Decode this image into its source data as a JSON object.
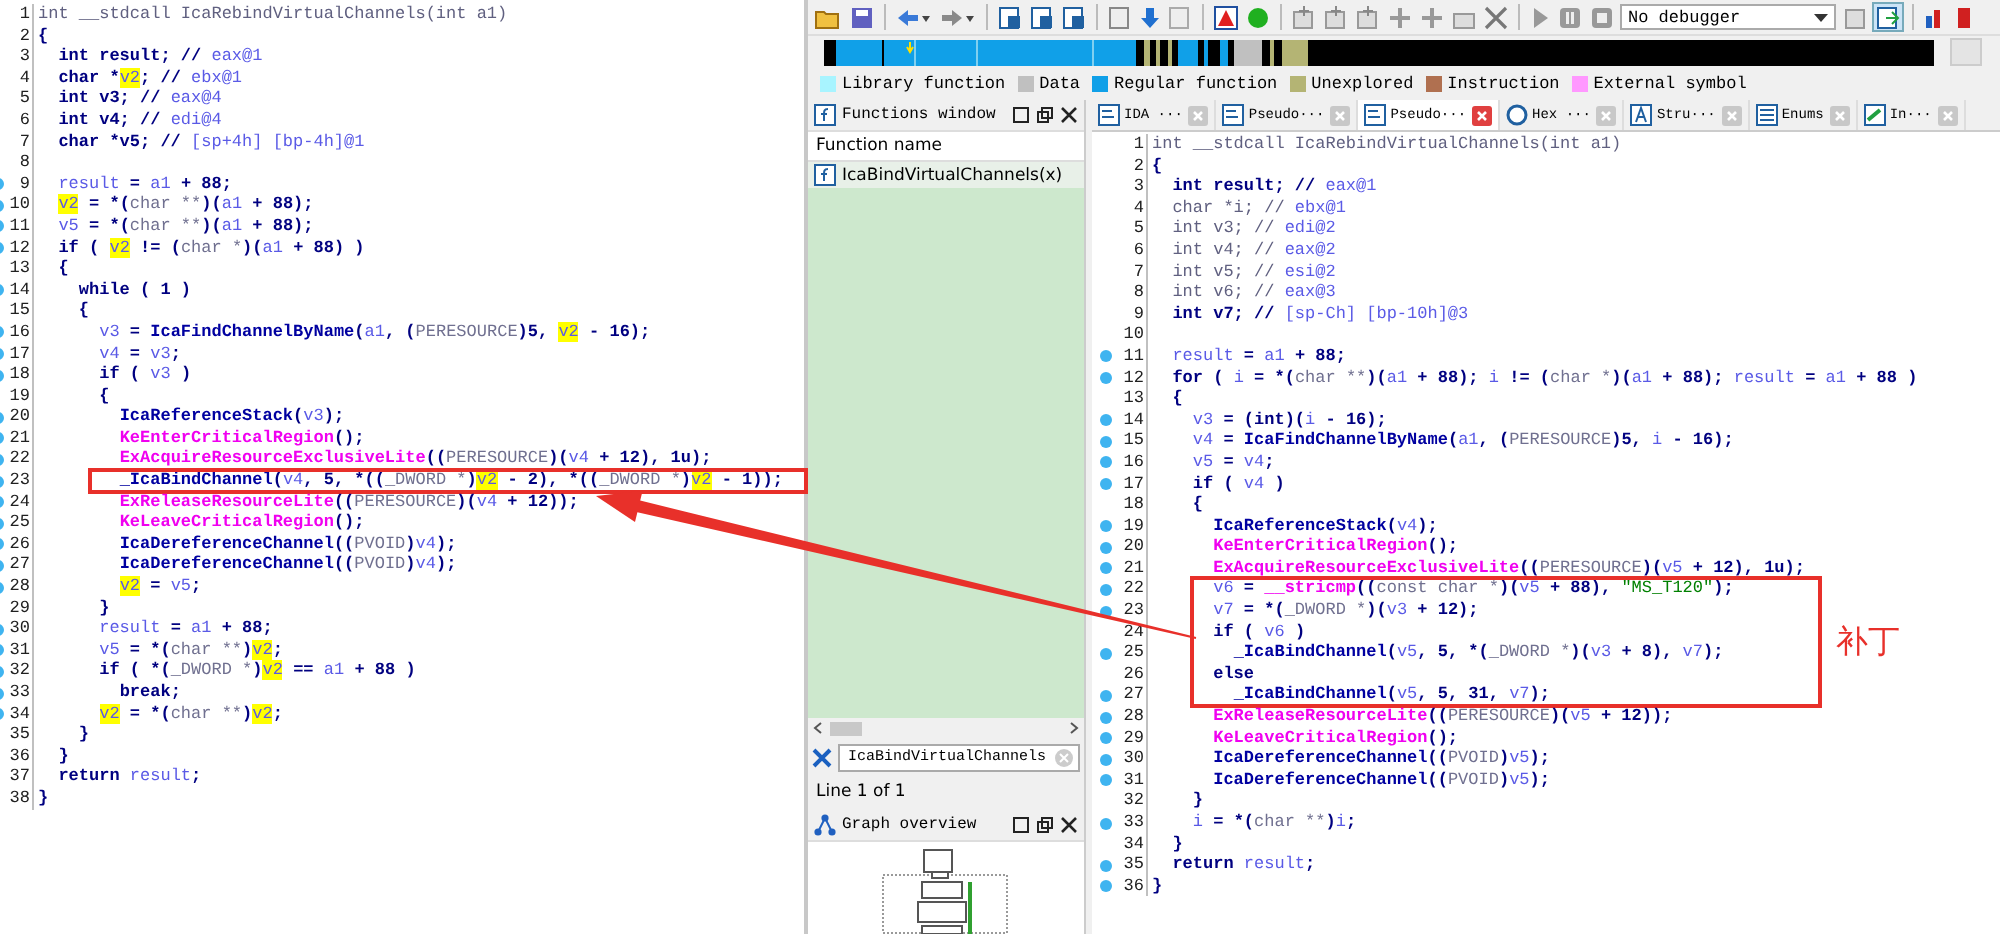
{
  "left_pane": {
    "lines_before": [
      {
        "number": "1",
        "dot": false,
        "tokens": [
          {
            "text": "int __stdcall IcaRebindVirtualChannels(int a1)",
            "kind": "dim"
          }
        ]
      },
      {
        "number": "2",
        "dot": false,
        "tokens": [
          {
            "text": "{",
            "kind": "plain"
          }
        ]
      },
      {
        "number": "3",
        "dot": false,
        "tokens": [
          {
            "text": "  int result; // ",
            "kind": "plain"
          },
          {
            "text": "eax@1",
            "kind": "var"
          }
        ]
      },
      {
        "number": "4",
        "dot": false,
        "tokens": [
          {
            "text": "  char *",
            "kind": "plain"
          },
          {
            "text": "v2",
            "kind": "mark"
          },
          {
            "text": "; // ",
            "kind": "plain"
          },
          {
            "text": "ebx@1",
            "kind": "var"
          }
        ]
      },
      {
        "number": "5",
        "dot": false,
        "tokens": [
          {
            "text": "  int v3; // ",
            "kind": "plain"
          },
          {
            "text": "eax@4",
            "kind": "var"
          }
        ]
      },
      {
        "number": "6",
        "dot": false,
        "tokens": [
          {
            "text": "  int v4; // ",
            "kind": "plain"
          },
          {
            "text": "edi@4",
            "kind": "var"
          }
        ]
      },
      {
        "number": "7",
        "dot": false,
        "tokens": [
          {
            "text": "  char *v5; // ",
            "kind": "plain"
          },
          {
            "text": "[sp+4h] [bp-4h]@1",
            "kind": "var"
          }
        ]
      },
      {
        "number": "8",
        "dot": false
      },
      {
        "number": "9",
        "dot": true,
        "tokens": [
          {
            "text": "  result",
            "kind": "var"
          },
          {
            "text": " = ",
            "kind": "plain"
          },
          {
            "text": "a1",
            "kind": "var"
          },
          {
            "text": " + 88;",
            "kind": "plain"
          }
        ]
      },
      {
        "number": "10",
        "dot": true,
        "tokens": [
          {
            "text": "  v2",
            "kind": "mark"
          },
          {
            "text": " = *(",
            "kind": "plain"
          },
          {
            "text": "char **",
            "kind": "cast"
          },
          {
            "text": ")(",
            "kind": "plain"
          },
          {
            "text": "a1",
            "kind": "var"
          },
          {
            "text": " + 88);",
            "kind": "plain"
          }
        ]
      },
      {
        "number": "11",
        "dot": true,
        "tokens": [
          {
            "text": "  v5",
            "kind": "var"
          },
          {
            "text": " = *(",
            "kind": "plain"
          },
          {
            "text": "char **",
            "kind": "cast"
          },
          {
            "text": ")(",
            "kind": "plain"
          },
          {
            "text": "a1",
            "kind": "var"
          },
          {
            "text": " + 88);",
            "kind": "plain"
          }
        ]
      },
      {
        "number": "12",
        "dot": true,
        "tokens": [
          {
            "text": "  if ( ",
            "kind": "plain"
          },
          {
            "text": "v2",
            "kind": "mark"
          },
          {
            "text": " != (",
            "kind": "plain"
          },
          {
            "text": "char *",
            "kind": "cast"
          },
          {
            "text": ")(",
            "kind": "plain"
          },
          {
            "text": "a1",
            "kind": "var"
          },
          {
            "text": " + 88) )",
            "kind": "plain"
          }
        ]
      },
      {
        "number": "13",
        "dot": false,
        "tokens": [
          {
            "text": "  {",
            "kind": "plain"
          }
        ]
      },
      {
        "number": "14",
        "dot": true,
        "tokens": [
          {
            "text": "    while ( 1 )",
            "kind": "plain"
          }
        ]
      },
      {
        "number": "15",
        "dot": false,
        "tokens": [
          {
            "text": "    {",
            "kind": "plain"
          }
        ]
      },
      {
        "number": "16",
        "dot": true,
        "tokens": [
          {
            "text": "      v3",
            "kind": "var"
          },
          {
            "text": " = ",
            "kind": "plain"
          },
          {
            "text": "IcaFindChannelByName",
            "kind": "func"
          },
          {
            "text": "(",
            "kind": "plain"
          },
          {
            "text": "a1",
            "kind": "var"
          },
          {
            "text": ", (",
            "kind": "plain"
          },
          {
            "text": "PERESOURCE",
            "kind": "cast"
          },
          {
            "text": ")5, ",
            "kind": "plain"
          },
          {
            "text": "v2",
            "kind": "mark"
          },
          {
            "text": " - 16);",
            "kind": "plain"
          }
        ]
      },
      {
        "number": "17",
        "dot": true,
        "tokens": [
          {
            "text": "      v4",
            "kind": "var"
          },
          {
            "text": " = ",
            "kind": "plain"
          },
          {
            "text": "v3",
            "kind": "var"
          },
          {
            "text": ";",
            "kind": "plain"
          }
        ]
      },
      {
        "number": "18",
        "dot": true,
        "tokens": [
          {
            "text": "      if ( ",
            "kind": "plain"
          },
          {
            "text": "v3",
            "kind": "var"
          },
          {
            "text": " )",
            "kind": "plain"
          }
        ]
      },
      {
        "number": "19",
        "dot": false,
        "tokens": [
          {
            "text": "      {",
            "kind": "plain"
          }
        ]
      },
      {
        "number": "20",
        "dot": true,
        "tokens": [
          {
            "text": "        IcaReferenceStack",
            "kind": "func"
          },
          {
            "text": "(",
            "kind": "plain"
          },
          {
            "text": "v3",
            "kind": "var"
          },
          {
            "text": ");",
            "kind": "plain"
          }
        ]
      },
      {
        "number": "21",
        "dot": true,
        "tokens": [
          {
            "text": "        KeEnterCriticalRegion",
            "kind": "import"
          },
          {
            "text": "();",
            "kind": "plain"
          }
        ]
      },
      {
        "number": "22",
        "dot": true,
        "tokens": [
          {
            "text": "        ExAcquireResourceExclusiveLite",
            "kind": "import"
          },
          {
            "text": "((",
            "kind": "plain"
          },
          {
            "text": "PERESOURCE",
            "kind": "cast"
          },
          {
            "text": ")(",
            "kind": "plain"
          },
          {
            "text": "v4",
            "kind": "var"
          },
          {
            "text": " + 12), 1u);",
            "kind": "plain"
          }
        ]
      }
    ],
    "boxed_lines": [
      {
        "number": "23",
        "dot": true,
        "tokens": [
          {
            "text": "        _IcaBindChannel",
            "kind": "func"
          },
          {
            "text": "(",
            "kind": "plain"
          },
          {
            "text": "v4",
            "kind": "var"
          },
          {
            "text": ", 5, *((",
            "kind": "plain"
          },
          {
            "text": "_DWORD *",
            "kind": "cast"
          },
          {
            "text": ")",
            "kind": "plain"
          },
          {
            "text": "v2",
            "kind": "mark"
          },
          {
            "text": " - 2), *((",
            "kind": "plain"
          },
          {
            "text": "_DWORD *",
            "kind": "cast"
          },
          {
            "text": ")",
            "kind": "plain"
          },
          {
            "text": "v2",
            "kind": "mark"
          },
          {
            "text": " - 1));",
            "kind": "plain"
          }
        ]
      }
    ],
    "lines_after": [
      {
        "number": "24",
        "dot": true,
        "tokens": [
          {
            "text": "        ExReleaseResourceLite",
            "kind": "import"
          },
          {
            "text": "((",
            "kind": "plain"
          },
          {
            "text": "PERESOURCE",
            "kind": "cast"
          },
          {
            "text": ")(",
            "kind": "plain"
          },
          {
            "text": "v4",
            "kind": "var"
          },
          {
            "text": " + 12));",
            "kind": "plain"
          }
        ]
      },
      {
        "number": "25",
        "dot": true,
        "tokens": [
          {
            "text": "        KeLeaveCriticalRegion",
            "kind": "import"
          },
          {
            "text": "();",
            "kind": "plain"
          }
        ]
      },
      {
        "number": "26",
        "dot": true,
        "tokens": [
          {
            "text": "        IcaDereferenceChannel",
            "kind": "func"
          },
          {
            "text": "((",
            "kind": "plain"
          },
          {
            "text": "PVOID",
            "kind": "cast"
          },
          {
            "text": ")",
            "kind": "plain"
          },
          {
            "text": "v4",
            "kind": "var"
          },
          {
            "text": ");",
            "kind": "plain"
          }
        ]
      },
      {
        "number": "27",
        "dot": true,
        "tokens": [
          {
            "text": "        IcaDereferenceChannel",
            "kind": "func"
          },
          {
            "text": "((",
            "kind": "plain"
          },
          {
            "text": "PVOID",
            "kind": "cast"
          },
          {
            "text": ")",
            "kind": "plain"
          },
          {
            "text": "v4",
            "kind": "var"
          },
          {
            "text": ");",
            "kind": "plain"
          }
        ]
      },
      {
        "number": "28",
        "dot": true,
        "tokens": [
          {
            "text": "        v2",
            "kind": "mark"
          },
          {
            "text": " = ",
            "kind": "plain"
          },
          {
            "text": "v5",
            "kind": "var"
          },
          {
            "text": ";",
            "kind": "plain"
          }
        ]
      },
      {
        "number": "29",
        "dot": false,
        "tokens": [
          {
            "text": "      }",
            "kind": "plain"
          }
        ]
      },
      {
        "number": "30",
        "dot": true,
        "tokens": [
          {
            "text": "      result",
            "kind": "var"
          },
          {
            "text": " = ",
            "kind": "plain"
          },
          {
            "text": "a1",
            "kind": "var"
          },
          {
            "text": " + 88;",
            "kind": "plain"
          }
        ]
      },
      {
        "number": "31",
        "dot": true,
        "tokens": [
          {
            "text": "      v5",
            "kind": "var"
          },
          {
            "text": " = *(",
            "kind": "plain"
          },
          {
            "text": "char **",
            "kind": "cast"
          },
          {
            "text": ")",
            "kind": "plain"
          },
          {
            "text": "v2",
            "kind": "mark"
          },
          {
            "text": ";",
            "kind": "plain"
          }
        ]
      },
      {
        "number": "32",
        "dot": true,
        "tokens": [
          {
            "text": "      if ( *(",
            "kind": "plain"
          },
          {
            "text": "_DWORD *",
            "kind": "cast"
          },
          {
            "text": ")",
            "kind": "plain"
          },
          {
            "text": "v2",
            "kind": "mark"
          },
          {
            "text": " == ",
            "kind": "plain"
          },
          {
            "text": "a1",
            "kind": "var"
          },
          {
            "text": " + 88 )",
            "kind": "plain"
          }
        ]
      },
      {
        "number": "33",
        "dot": true,
        "tokens": [
          {
            "text": "        break;",
            "kind": "plain"
          }
        ]
      },
      {
        "number": "34",
        "dot": true,
        "tokens": [
          {
            "text": "      v2",
            "kind": "mark"
          },
          {
            "text": " = *(",
            "kind": "plain"
          },
          {
            "text": "char **",
            "kind": "cast"
          },
          {
            "text": ")",
            "kind": "plain"
          },
          {
            "text": "v2",
            "kind": "mark"
          },
          {
            "text": ";",
            "kind": "plain"
          }
        ]
      },
      {
        "number": "35",
        "dot": false,
        "tokens": [
          {
            "text": "    }",
            "kind": "plain"
          }
        ]
      },
      {
        "number": "36",
        "dot": false,
        "tokens": [
          {
            "text": "  }",
            "kind": "plain"
          }
        ]
      },
      {
        "number": "37",
        "dot": false,
        "tokens": [
          {
            "text": "  return ",
            "kind": "plain"
          },
          {
            "text": "result",
            "kind": "var"
          },
          {
            "text": ";",
            "kind": "plain"
          }
        ]
      },
      {
        "number": "38",
        "dot": false,
        "tokens": [
          {
            "text": "}",
            "kind": "plain"
          }
        ]
      }
    ]
  },
  "toolbar": {
    "debugger": "No debugger"
  },
  "legend": [
    {
      "label": "Library function",
      "color": "#a8f4ff"
    },
    {
      "label": "Data",
      "color": "#c0c0c0"
    },
    {
      "label": "Regular function",
      "color": "#10a0e8"
    },
    {
      "label": "Unexplored",
      "color": "#b4b474"
    },
    {
      "label": "Instruction",
      "color": "#b07050"
    },
    {
      "label": "External symbol",
      "color": "#ff98ff"
    }
  ],
  "functions_window": {
    "title": "Functions window",
    "column": "Function name",
    "items": [
      {
        "name": "IcaBindVirtualChannels(x)",
        "selected": true
      }
    ],
    "search": {
      "value": "IcaBindVirtualChannels"
    },
    "status": "Line 1 of 1"
  },
  "graph_overview": {
    "title": "Graph overview"
  },
  "tabs": [
    {
      "label": "IDA ···",
      "kind": "view",
      "selected": false
    },
    {
      "label": "Pseudo···",
      "kind": "code",
      "selected": false
    },
    {
      "label": "Pseudo···",
      "kind": "code",
      "selected": true
    },
    {
      "label": "Hex ···",
      "kind": "hex",
      "selected": false
    },
    {
      "label": "Stru···",
      "kind": "struct",
      "selected": false
    },
    {
      "label": "Enums",
      "kind": "enum",
      "selected": false
    },
    {
      "label": "In···",
      "kind": "import",
      "selected": false
    }
  ],
  "right_pane": {
    "note": "补丁",
    "lines_before": [
      {
        "number": "1",
        "dot": false,
        "tokens": [
          {
            "text": "int __stdcall IcaRebindVirtualChannels(int a1)",
            "kind": "dim"
          }
        ]
      },
      {
        "number": "2",
        "dot": false,
        "tokens": [
          {
            "text": "{",
            "kind": "plain"
          }
        ]
      },
      {
        "number": "3",
        "dot": false,
        "tokens": [
          {
            "text": "  int result; // ",
            "kind": "plain"
          },
          {
            "text": "eax@1",
            "kind": "var"
          }
        ]
      },
      {
        "number": "4",
        "dot": false,
        "tokens": [
          {
            "text": "  char *i; // ",
            "kind": "dim"
          },
          {
            "text": "ebx@1",
            "kind": "var"
          }
        ]
      },
      {
        "number": "5",
        "dot": false,
        "tokens": [
          {
            "text": "  int v3; // ",
            "kind": "dim"
          },
          {
            "text": "edi@2",
            "kind": "var"
          }
        ]
      },
      {
        "number": "6",
        "dot": false,
        "tokens": [
          {
            "text": "  int v4; // ",
            "kind": "dim"
          },
          {
            "text": "eax@2",
            "kind": "var"
          }
        ]
      },
      {
        "number": "7",
        "dot": false,
        "tokens": [
          {
            "text": "  int v5; // ",
            "kind": "dim"
          },
          {
            "text": "esi@2",
            "kind": "var"
          }
        ]
      },
      {
        "number": "8",
        "dot": false,
        "tokens": [
          {
            "text": "  int v6; // ",
            "kind": "dim"
          },
          {
            "text": "eax@3",
            "kind": "var"
          }
        ]
      },
      {
        "number": "9",
        "dot": false,
        "tokens": [
          {
            "text": "  int v7; // ",
            "kind": "plain"
          },
          {
            "text": "[sp-Ch] [bp-10h]@3",
            "kind": "var"
          }
        ]
      },
      {
        "number": "10",
        "dot": false
      },
      {
        "number": "11",
        "dot": true,
        "tokens": [
          {
            "text": "  result",
            "kind": "var"
          },
          {
            "text": " = ",
            "kind": "plain"
          },
          {
            "text": "a1",
            "kind": "var"
          },
          {
            "text": " + 88;",
            "kind": "plain"
          }
        ]
      },
      {
        "number": "12",
        "dot": true,
        "tokens": [
          {
            "text": "  for ( ",
            "kind": "plain"
          },
          {
            "text": "i",
            "kind": "var"
          },
          {
            "text": " = *(",
            "kind": "plain"
          },
          {
            "text": "char **",
            "kind": "cast"
          },
          {
            "text": ")(",
            "kind": "plain"
          },
          {
            "text": "a1",
            "kind": "var"
          },
          {
            "text": " + 88); ",
            "kind": "plain"
          },
          {
            "text": "i",
            "kind": "var"
          },
          {
            "text": " != (",
            "kind": "plain"
          },
          {
            "text": "char *",
            "kind": "cast"
          },
          {
            "text": ")(",
            "kind": "plain"
          },
          {
            "text": "a1",
            "kind": "var"
          },
          {
            "text": " + 88); ",
            "kind": "plain"
          },
          {
            "text": "result",
            "kind": "var"
          },
          {
            "text": " = ",
            "kind": "plain"
          },
          {
            "text": "a1",
            "kind": "var"
          },
          {
            "text": " + 88 )",
            "kind": "plain"
          }
        ]
      },
      {
        "number": "13",
        "dot": false,
        "tokens": [
          {
            "text": "  {",
            "kind": "plain"
          }
        ]
      },
      {
        "number": "14",
        "dot": true,
        "tokens": [
          {
            "text": "    v3",
            "kind": "var"
          },
          {
            "text": " = (int)(",
            "kind": "plain"
          },
          {
            "text": "i",
            "kind": "var"
          },
          {
            "text": " - 16);",
            "kind": "plain"
          }
        ]
      },
      {
        "number": "15",
        "dot": true,
        "tokens": [
          {
            "text": "    v4",
            "kind": "var"
          },
          {
            "text": " = ",
            "kind": "plain"
          },
          {
            "text": "IcaFindChannelByName",
            "kind": "func"
          },
          {
            "text": "(",
            "kind": "plain"
          },
          {
            "text": "a1",
            "kind": "var"
          },
          {
            "text": ", (",
            "kind": "plain"
          },
          {
            "text": "PERESOURCE",
            "kind": "cast"
          },
          {
            "text": ")5, ",
            "kind": "plain"
          },
          {
            "text": "i",
            "kind": "var"
          },
          {
            "text": " - 16);",
            "kind": "plain"
          }
        ]
      },
      {
        "number": "16",
        "dot": true,
        "tokens": [
          {
            "text": "    v5",
            "kind": "var"
          },
          {
            "text": " = ",
            "kind": "plain"
          },
          {
            "text": "v4",
            "kind": "var"
          },
          {
            "text": ";",
            "kind": "plain"
          }
        ]
      },
      {
        "number": "17",
        "dot": true,
        "tokens": [
          {
            "text": "    if ( ",
            "kind": "plain"
          },
          {
            "text": "v4",
            "kind": "var"
          },
          {
            "text": " )",
            "kind": "plain"
          }
        ]
      },
      {
        "number": "18",
        "dot": false,
        "tokens": [
          {
            "text": "    {",
            "kind": "plain"
          }
        ]
      },
      {
        "number": "19",
        "dot": true,
        "tokens": [
          {
            "text": "      IcaReferenceStack",
            "kind": "func"
          },
          {
            "text": "(",
            "kind": "plain"
          },
          {
            "text": "v4",
            "kind": "var"
          },
          {
            "text": ");",
            "kind": "plain"
          }
        ]
      },
      {
        "number": "20",
        "dot": true,
        "tokens": [
          {
            "text": "      KeEnterCriticalRegion",
            "kind": "import"
          },
          {
            "text": "();",
            "kind": "plain"
          }
        ]
      },
      {
        "number": "21",
        "dot": true,
        "tokens": [
          {
            "text": "      ExAcquireResourceExclusiveLite",
            "kind": "import"
          },
          {
            "text": "((",
            "kind": "plain"
          },
          {
            "text": "PERESOURCE",
            "kind": "cast"
          },
          {
            "text": ")(",
            "kind": "plain"
          },
          {
            "text": "v5",
            "kind": "var"
          },
          {
            "text": " + 12), 1u);",
            "kind": "plain"
          }
        ]
      }
    ],
    "boxed_lines": [
      {
        "number": "22",
        "dot": true,
        "tokens": [
          {
            "text": "      v6",
            "kind": "var"
          },
          {
            "text": " = ",
            "kind": "plain"
          },
          {
            "text": "__stricmp",
            "kind": "import"
          },
          {
            "text": "((",
            "kind": "plain"
          },
          {
            "text": "const char *",
            "kind": "cast"
          },
          {
            "text": ")(",
            "kind": "plain"
          },
          {
            "text": "v5",
            "kind": "var"
          },
          {
            "text": " + 88), ",
            "kind": "plain"
          },
          {
            "text": "\"MS_T120\"",
            "kind": "string"
          },
          {
            "text": ");",
            "kind": "plain"
          }
        ]
      },
      {
        "number": "23",
        "dot": true,
        "tokens": [
          {
            "text": "      v7",
            "kind": "var"
          },
          {
            "text": " = *(",
            "kind": "plain"
          },
          {
            "text": "_DWORD *",
            "kind": "cast"
          },
          {
            "text": ")(",
            "kind": "plain"
          },
          {
            "text": "v3",
            "kind": "var"
          },
          {
            "text": " + 12);",
            "kind": "plain"
          }
        ]
      },
      {
        "number": "24",
        "dot": false,
        "tokens": [
          {
            "text": "      if ( ",
            "kind": "plain"
          },
          {
            "text": "v6",
            "kind": "var"
          },
          {
            "text": " )",
            "kind": "plain"
          }
        ]
      },
      {
        "number": "25",
        "dot": true,
        "tokens": [
          {
            "text": "        _IcaBindChannel",
            "kind": "func"
          },
          {
            "text": "(",
            "kind": "plain"
          },
          {
            "text": "v5",
            "kind": "var"
          },
          {
            "text": ", 5, *(",
            "kind": "plain"
          },
          {
            "text": "_DWORD *",
            "kind": "cast"
          },
          {
            "text": ")(",
            "kind": "plain"
          },
          {
            "text": "v3",
            "kind": "var"
          },
          {
            "text": " + 8), ",
            "kind": "plain"
          },
          {
            "text": "v7",
            "kind": "var"
          },
          {
            "text": ");",
            "kind": "plain"
          }
        ]
      },
      {
        "number": "26",
        "dot": false,
        "tokens": [
          {
            "text": "      else",
            "kind": "plain"
          }
        ]
      },
      {
        "number": "27",
        "dot": true,
        "tokens": [
          {
            "text": "        _IcaBindChannel",
            "kind": "func"
          },
          {
            "text": "(",
            "kind": "plain"
          },
          {
            "text": "v5",
            "kind": "var"
          },
          {
            "text": ", 5, 31, ",
            "kind": "plain"
          },
          {
            "text": "v7",
            "kind": "var"
          },
          {
            "text": ");",
            "kind": "plain"
          }
        ]
      }
    ],
    "lines_after": [
      {
        "number": "28",
        "dot": true,
        "tokens": [
          {
            "text": "      ExReleaseResourceLite",
            "kind": "import"
          },
          {
            "text": "((",
            "kind": "plain"
          },
          {
            "text": "PERESOURCE",
            "kind": "cast"
          },
          {
            "text": ")(",
            "kind": "plain"
          },
          {
            "text": "v5",
            "kind": "var"
          },
          {
            "text": " + 12));",
            "kind": "plain"
          }
        ]
      },
      {
        "number": "29",
        "dot": true,
        "tokens": [
          {
            "text": "      KeLeaveCriticalRegion",
            "kind": "import"
          },
          {
            "text": "();",
            "kind": "plain"
          }
        ]
      },
      {
        "number": "30",
        "dot": true,
        "tokens": [
          {
            "text": "      IcaDereferenceChannel",
            "kind": "func"
          },
          {
            "text": "((",
            "kind": "plain"
          },
          {
            "text": "PVOID",
            "kind": "cast"
          },
          {
            "text": ")",
            "kind": "plain"
          },
          {
            "text": "v5",
            "kind": "var"
          },
          {
            "text": ");",
            "kind": "plain"
          }
        ]
      },
      {
        "number": "31",
        "dot": true,
        "tokens": [
          {
            "text": "      IcaDereferenceChannel",
            "kind": "func"
          },
          {
            "text": "((",
            "kind": "plain"
          },
          {
            "text": "PVOID",
            "kind": "cast"
          },
          {
            "text": ")",
            "kind": "plain"
          },
          {
            "text": "v5",
            "kind": "var"
          },
          {
            "text": ");",
            "kind": "plain"
          }
        ]
      },
      {
        "number": "32",
        "dot": false,
        "tokens": [
          {
            "text": "    }",
            "kind": "plain"
          }
        ]
      },
      {
        "number": "33",
        "dot": true,
        "tokens": [
          {
            "text": "    i",
            "kind": "var"
          },
          {
            "text": " = *(",
            "kind": "plain"
          },
          {
            "text": "char **",
            "kind": "cast"
          },
          {
            "text": ")",
            "kind": "plain"
          },
          {
            "text": "i",
            "kind": "var"
          },
          {
            "text": ";",
            "kind": "plain"
          }
        ]
      },
      {
        "number": "34",
        "dot": false,
        "tokens": [
          {
            "text": "  }",
            "kind": "plain"
          }
        ]
      },
      {
        "number": "35",
        "dot": true,
        "tokens": [
          {
            "text": "  return ",
            "kind": "plain"
          },
          {
            "text": "result",
            "kind": "var"
          },
          {
            "text": ";",
            "kind": "plain"
          }
        ]
      },
      {
        "number": "36",
        "dot": true,
        "tokens": [
          {
            "text": "}",
            "kind": "plain"
          }
        ]
      }
    ]
  }
}
